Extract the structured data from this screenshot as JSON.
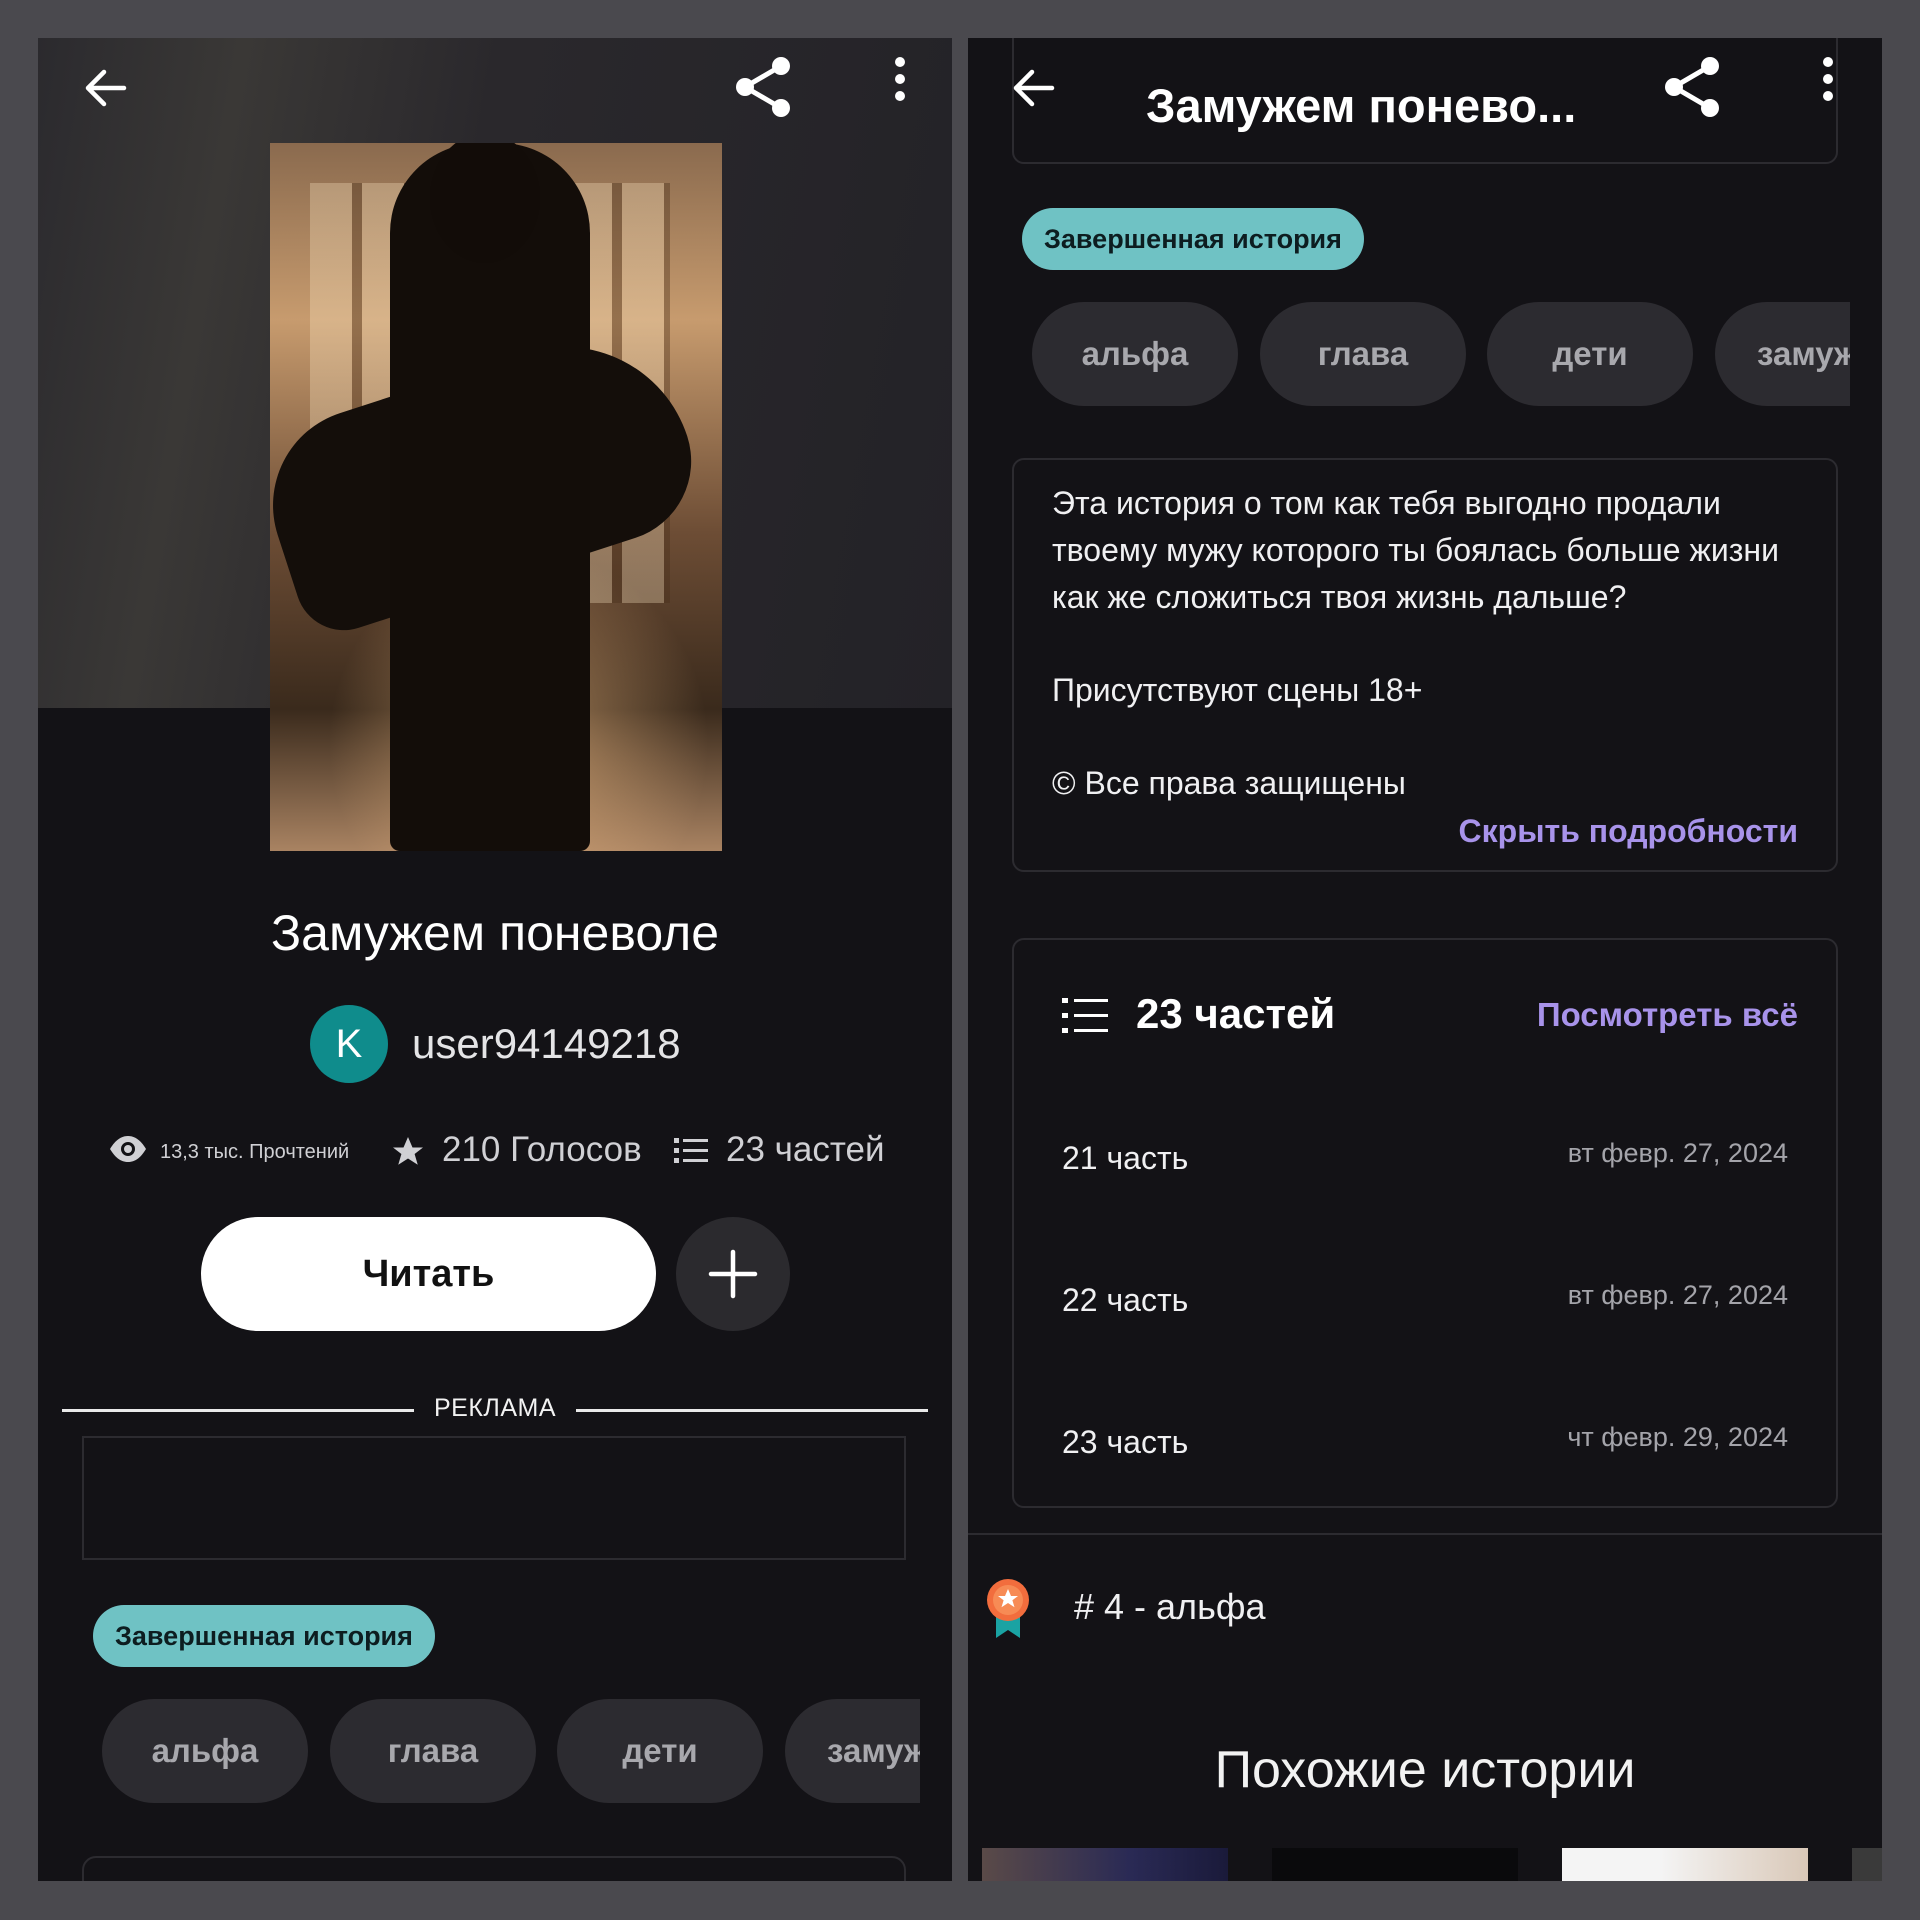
{
  "left": {
    "title": "Замужем поневоле",
    "author": {
      "initial": "K",
      "username": "user94149218"
    },
    "stats": {
      "reads": "13,3 тыс. Прочтений",
      "votes": "210 Голосов",
      "parts": "23 частей"
    },
    "read_button": "Читать",
    "ad_label": "РЕКЛАМА",
    "status_badge": "Завершенная история",
    "tags": [
      "альфа",
      "глава",
      "дети",
      "замуж"
    ]
  },
  "right": {
    "header_title": "Замужем понево...",
    "status_badge": "Завершенная история",
    "tags": [
      "альфа",
      "глава",
      "дети",
      "замуж"
    ],
    "description": [
      "Эта история о том как тебя выгодно продали твоему мужу которого ты боялась больше жизни как же сложиться твоя жизнь дальше?",
      "Присутствуют сцены 18+",
      "© Все права защищены"
    ],
    "hide_details": "Скрыть подробности",
    "parts_heading": "23 частей",
    "see_all": "Посмотреть всё",
    "parts": [
      {
        "name": "21 часть",
        "date": "вт февр. 27, 2024"
      },
      {
        "name": "22 часть",
        "date": "вт февр. 27, 2024"
      },
      {
        "name": "23 часть",
        "date": "чт февр. 29, 2024"
      }
    ],
    "ranking": "# 4 - альфа",
    "similar_heading": "Похожие истории"
  },
  "colors": {
    "background": "#131216",
    "accent_teal": "#6fc2c4",
    "link_purple": "#a893ea",
    "avatar_teal": "#0f8c8c",
    "chip": "#2c2b30"
  }
}
